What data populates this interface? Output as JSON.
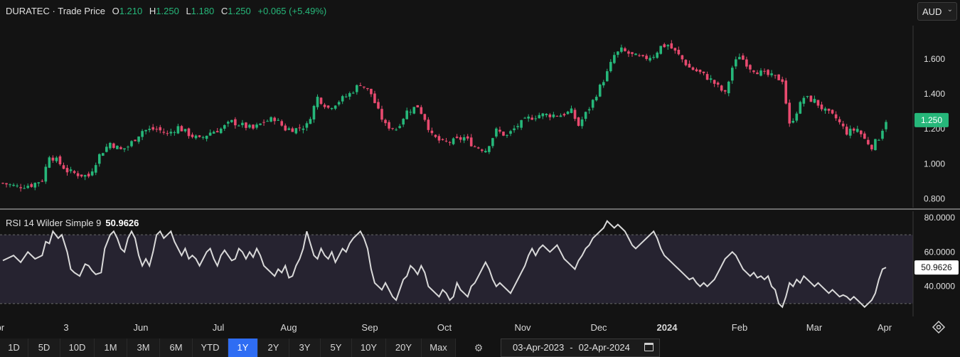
{
  "header": {
    "symbol": "DURATEC",
    "separator": "·",
    "series_label": "Trade Price",
    "ohlc": [
      {
        "key": "O",
        "value": "1.210"
      },
      {
        "key": "H",
        "value": "1.250"
      },
      {
        "key": "L",
        "value": "1.180"
      },
      {
        "key": "C",
        "value": "1.250"
      }
    ],
    "change": "+0.065 (+5.49%)"
  },
  "currency": {
    "label": "AUD",
    "icon": "chevron-down-icon"
  },
  "rsi_legend": {
    "label": "RSI 14 Wilder Simple 9",
    "value": "50.9626"
  },
  "colors": {
    "up": "#26b77a",
    "down": "#e84a6f",
    "rsi": "#d9d9d9",
    "rsi_band": "#262330",
    "price_tag": "#26b77a"
  },
  "range_buttons": [
    {
      "label": "1D"
    },
    {
      "label": "5D"
    },
    {
      "label": "10D"
    },
    {
      "label": "1M"
    },
    {
      "label": "3M"
    },
    {
      "label": "6M"
    },
    {
      "label": "YTD"
    },
    {
      "label": "1Y",
      "active": true
    },
    {
      "label": "2Y"
    },
    {
      "label": "3Y"
    },
    {
      "label": "5Y"
    },
    {
      "label": "10Y"
    },
    {
      "label": "20Y"
    },
    {
      "label": "Max"
    }
  ],
  "settings_icon": "gear-icon",
  "date_range": {
    "start": "03-Apr-2023",
    "sep": "-",
    "end": "02-Apr-2024",
    "icon": "calendar-icon"
  },
  "chart_data": [
    {
      "type": "candlestick",
      "series_name": "Trade Price",
      "y_ticks": [
        "0.800",
        "1.000",
        "1.200",
        "1.400",
        "1.600"
      ],
      "ylim": [
        0.75,
        1.79
      ],
      "last_price_label": "1.250",
      "x_labels": [
        "Apr",
        "3",
        "Jun",
        "Jul",
        "Aug",
        "Sep",
        "Oct",
        "Nov",
        "Dec",
        "2024",
        "Feb",
        "Mar",
        "Apr"
      ],
      "close_path": [
        [
          0,
          0.89
        ],
        [
          8,
          0.87
        ],
        [
          16,
          0.88
        ],
        [
          22,
          0.91
        ],
        [
          26,
          1.05
        ],
        [
          30,
          1.02
        ],
        [
          36,
          0.96
        ],
        [
          42,
          0.94
        ],
        [
          48,
          0.93
        ],
        [
          54,
          1.05
        ],
        [
          60,
          1.12
        ],
        [
          66,
          1.08
        ],
        [
          70,
          1.1
        ],
        [
          78,
          1.19
        ],
        [
          86,
          1.2
        ],
        [
          92,
          1.17
        ],
        [
          98,
          1.21
        ],
        [
          104,
          1.17
        ],
        [
          110,
          1.14
        ],
        [
          116,
          1.18
        ],
        [
          122,
          1.2
        ],
        [
          128,
          1.24
        ],
        [
          134,
          1.22
        ],
        [
          140,
          1.2
        ],
        [
          146,
          1.24
        ],
        [
          152,
          1.26
        ],
        [
          158,
          1.2
        ],
        [
          164,
          1.2
        ],
        [
          170,
          1.22
        ],
        [
          176,
          1.38
        ],
        [
          182,
          1.32
        ],
        [
          188,
          1.36
        ],
        [
          194,
          1.4
        ],
        [
          200,
          1.46
        ],
        [
          206,
          1.4
        ],
        [
          210,
          1.3
        ],
        [
          214,
          1.22
        ],
        [
          220,
          1.2
        ],
        [
          226,
          1.3
        ],
        [
          232,
          1.33
        ],
        [
          236,
          1.26
        ],
        [
          240,
          1.16
        ],
        [
          246,
          1.12
        ],
        [
          252,
          1.13
        ],
        [
          258,
          1.15
        ],
        [
          264,
          1.1
        ],
        [
          270,
          1.08
        ],
        [
          276,
          1.19
        ],
        [
          282,
          1.16
        ],
        [
          288,
          1.22
        ],
        [
          294,
          1.26
        ],
        [
          300,
          1.28
        ],
        [
          306,
          1.28
        ],
        [
          312,
          1.28
        ],
        [
          318,
          1.3
        ],
        [
          322,
          1.22
        ],
        [
          328,
          1.32
        ],
        [
          334,
          1.44
        ],
        [
          338,
          1.52
        ],
        [
          342,
          1.62
        ],
        [
          346,
          1.65
        ],
        [
          352,
          1.62
        ],
        [
          358,
          1.6
        ],
        [
          364,
          1.62
        ],
        [
          368,
          1.67
        ],
        [
          372,
          1.68
        ],
        [
          378,
          1.62
        ],
        [
          384,
          1.55
        ],
        [
          390,
          1.52
        ],
        [
          396,
          1.48
        ],
        [
          400,
          1.44
        ],
        [
          404,
          1.4
        ],
        [
          408,
          1.55
        ],
        [
          412,
          1.62
        ],
        [
          418,
          1.55
        ],
        [
          424,
          1.52
        ],
        [
          430,
          1.5
        ],
        [
          436,
          1.48
        ],
        [
          440,
          1.22
        ],
        [
          444,
          1.3
        ],
        [
          448,
          1.38
        ],
        [
          454,
          1.36
        ],
        [
          460,
          1.3
        ],
        [
          466,
          1.26
        ],
        [
          472,
          1.18
        ],
        [
          478,
          1.2
        ],
        [
          482,
          1.14
        ],
        [
          486,
          1.1
        ],
        [
          490,
          1.15
        ],
        [
          494,
          1.25
        ]
      ]
    },
    {
      "type": "line",
      "series_name": "RSI 14 Wilder Simple 9",
      "y_ticks": [
        "80.0000",
        "60.0000",
        "40.0000"
      ],
      "ylim": [
        20,
        80
      ],
      "band": [
        30,
        70
      ],
      "last_value_label": "50.9626",
      "values": [
        [
          0,
          55
        ],
        [
          6,
          58
        ],
        [
          10,
          54
        ],
        [
          14,
          60
        ],
        [
          18,
          56
        ],
        [
          22,
          58
        ],
        [
          24,
          66
        ],
        [
          26,
          65
        ],
        [
          28,
          72
        ],
        [
          31,
          68
        ],
        [
          33,
          70
        ],
        [
          36,
          60
        ],
        [
          38,
          50
        ],
        [
          40,
          48
        ],
        [
          43,
          46
        ],
        [
          46,
          53
        ],
        [
          48,
          52
        ],
        [
          50,
          49
        ],
        [
          52,
          47
        ],
        [
          55,
          48
        ],
        [
          57,
          62
        ],
        [
          60,
          70
        ],
        [
          62,
          72
        ],
        [
          64,
          68
        ],
        [
          66,
          62
        ],
        [
          68,
          60
        ],
        [
          70,
          68
        ],
        [
          72,
          72
        ],
        [
          74,
          68
        ],
        [
          76,
          58
        ],
        [
          78,
          52
        ],
        [
          80,
          56
        ],
        [
          82,
          52
        ],
        [
          84,
          60
        ],
        [
          86,
          70
        ],
        [
          88,
          72
        ],
        [
          90,
          68
        ],
        [
          92,
          70
        ],
        [
          94,
          72
        ],
        [
          96,
          66
        ],
        [
          98,
          62
        ],
        [
          100,
          58
        ],
        [
          102,
          62
        ],
        [
          104,
          56
        ],
        [
          106,
          58
        ],
        [
          108,
          56
        ],
        [
          110,
          52
        ],
        [
          112,
          56
        ],
        [
          114,
          60
        ],
        [
          116,
          62
        ],
        [
          118,
          56
        ],
        [
          120,
          52
        ],
        [
          122,
          58
        ],
        [
          124,
          61
        ],
        [
          126,
          58
        ],
        [
          128,
          55
        ],
        [
          130,
          56
        ],
        [
          132,
          62
        ],
        [
          134,
          60
        ],
        [
          136,
          56
        ],
        [
          138,
          60
        ],
        [
          140,
          57
        ],
        [
          142,
          62
        ],
        [
          144,
          58
        ],
        [
          146,
          52
        ],
        [
          148,
          50
        ],
        [
          150,
          48
        ],
        [
          152,
          46
        ],
        [
          154,
          50
        ],
        [
          156,
          48
        ],
        [
          158,
          52
        ],
        [
          160,
          45
        ],
        [
          162,
          46
        ],
        [
          164,
          52
        ],
        [
          166,
          56
        ],
        [
          168,
          62
        ],
        [
          170,
          72
        ],
        [
          172,
          65
        ],
        [
          174,
          58
        ],
        [
          176,
          56
        ],
        [
          178,
          62
        ],
        [
          180,
          58
        ],
        [
          182,
          56
        ],
        [
          184,
          60
        ],
        [
          186,
          54
        ],
        [
          188,
          58
        ],
        [
          190,
          62
        ],
        [
          192,
          60
        ],
        [
          194,
          65
        ],
        [
          196,
          68
        ],
        [
          198,
          70
        ],
        [
          200,
          72
        ],
        [
          202,
          68
        ],
        [
          204,
          62
        ],
        [
          206,
          50
        ],
        [
          208,
          42
        ],
        [
          210,
          40
        ],
        [
          212,
          38
        ],
        [
          214,
          42
        ],
        [
          216,
          38
        ],
        [
          218,
          34
        ],
        [
          220,
          32
        ],
        [
          222,
          38
        ],
        [
          224,
          44
        ],
        [
          226,
          46
        ],
        [
          228,
          52
        ],
        [
          230,
          50
        ],
        [
          232,
          47
        ],
        [
          234,
          52
        ],
        [
          236,
          48
        ],
        [
          238,
          40
        ],
        [
          240,
          38
        ],
        [
          242,
          36
        ],
        [
          244,
          34
        ],
        [
          246,
          38
        ],
        [
          248,
          36
        ],
        [
          250,
          32
        ],
        [
          252,
          34
        ],
        [
          254,
          42
        ],
        [
          256,
          38
        ],
        [
          258,
          36
        ],
        [
          260,
          34
        ],
        [
          262,
          40
        ],
        [
          264,
          42
        ],
        [
          266,
          46
        ],
        [
          268,
          50
        ],
        [
          270,
          54
        ],
        [
          272,
          50
        ],
        [
          274,
          44
        ],
        [
          276,
          40
        ],
        [
          278,
          42
        ],
        [
          280,
          40
        ],
        [
          282,
          38
        ],
        [
          284,
          36
        ],
        [
          286,
          40
        ],
        [
          288,
          44
        ],
        [
          290,
          48
        ],
        [
          292,
          52
        ],
        [
          294,
          58
        ],
        [
          296,
          62
        ],
        [
          298,
          58
        ],
        [
          300,
          62
        ],
        [
          302,
          64
        ],
        [
          304,
          62
        ],
        [
          306,
          60
        ],
        [
          308,
          62
        ],
        [
          310,
          64
        ],
        [
          312,
          60
        ],
        [
          314,
          56
        ],
        [
          316,
          54
        ],
        [
          318,
          52
        ],
        [
          320,
          50
        ],
        [
          322,
          55
        ],
        [
          324,
          58
        ],
        [
          326,
          62
        ],
        [
          328,
          64
        ],
        [
          330,
          68
        ],
        [
          332,
          70
        ],
        [
          334,
          72
        ],
        [
          336,
          74
        ],
        [
          338,
          78
        ],
        [
          340,
          76
        ],
        [
          342,
          74
        ],
        [
          344,
          76
        ],
        [
          346,
          74
        ],
        [
          348,
          72
        ],
        [
          350,
          68
        ],
        [
          352,
          64
        ],
        [
          354,
          62
        ],
        [
          356,
          64
        ],
        [
          358,
          66
        ],
        [
          360,
          68
        ],
        [
          362,
          70
        ],
        [
          364,
          72
        ],
        [
          366,
          68
        ],
        [
          368,
          62
        ],
        [
          370,
          58
        ],
        [
          372,
          56
        ],
        [
          374,
          54
        ],
        [
          376,
          52
        ],
        [
          378,
          50
        ],
        [
          380,
          48
        ],
        [
          382,
          46
        ],
        [
          384,
          44
        ],
        [
          386,
          45
        ],
        [
          388,
          42
        ],
        [
          390,
          40
        ],
        [
          392,
          42
        ],
        [
          394,
          40
        ],
        [
          396,
          42
        ],
        [
          398,
          44
        ],
        [
          400,
          48
        ],
        [
          402,
          52
        ],
        [
          404,
          56
        ],
        [
          406,
          58
        ],
        [
          408,
          60
        ],
        [
          410,
          58
        ],
        [
          412,
          54
        ],
        [
          414,
          50
        ],
        [
          416,
          48
        ],
        [
          418,
          46
        ],
        [
          420,
          48
        ],
        [
          422,
          45
        ],
        [
          424,
          46
        ],
        [
          426,
          44
        ],
        [
          428,
          46
        ],
        [
          430,
          40
        ],
        [
          432,
          38
        ],
        [
          434,
          30
        ],
        [
          436,
          28
        ],
        [
          438,
          34
        ],
        [
          440,
          42
        ],
        [
          442,
          40
        ],
        [
          444,
          44
        ],
        [
          446,
          42
        ],
        [
          448,
          46
        ],
        [
          450,
          44
        ],
        [
          452,
          42
        ],
        [
          454,
          40
        ],
        [
          456,
          42
        ],
        [
          458,
          40
        ],
        [
          460,
          38
        ],
        [
          462,
          36
        ],
        [
          464,
          38
        ],
        [
          466,
          36
        ],
        [
          468,
          34
        ],
        [
          470,
          35
        ],
        [
          472,
          34
        ],
        [
          474,
          32
        ],
        [
          476,
          34
        ],
        [
          478,
          32
        ],
        [
          480,
          30
        ],
        [
          482,
          28
        ],
        [
          484,
          30
        ],
        [
          486,
          32
        ],
        [
          488,
          36
        ],
        [
          490,
          44
        ],
        [
          492,
          50
        ],
        [
          494,
          51
        ]
      ]
    }
  ]
}
